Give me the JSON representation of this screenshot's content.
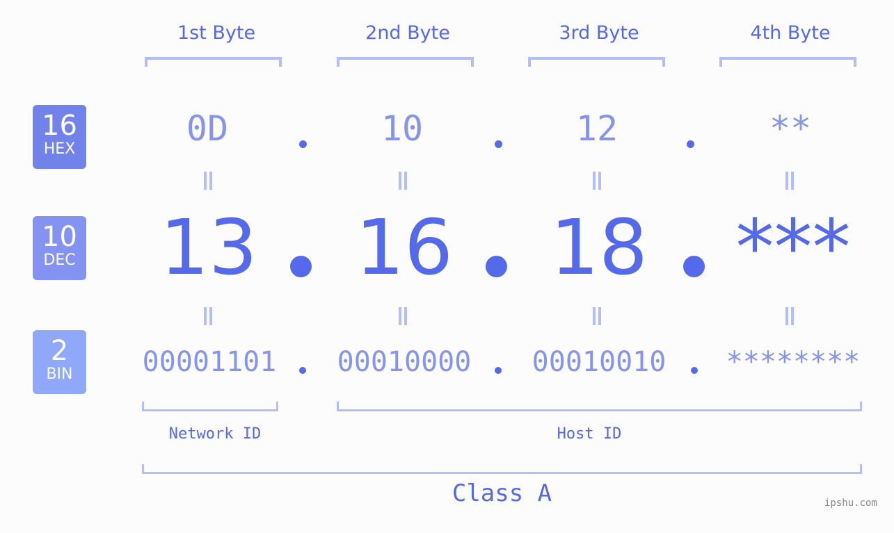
{
  "byte_headers": [
    "1st Byte",
    "2nd Byte",
    "3rd Byte",
    "4th Byte"
  ],
  "badges": [
    {
      "number": "16",
      "label": "HEX",
      "color": "#7282eb"
    },
    {
      "number": "10",
      "label": "DEC",
      "color": "#8493f1"
    },
    {
      "number": "2",
      "label": "BIN",
      "color": "#8fa8f9"
    }
  ],
  "hex": [
    "0D",
    "10",
    "12",
    "**"
  ],
  "dec": [
    "13",
    "16",
    "18",
    "***"
  ],
  "bin": [
    "00001101",
    "00010000",
    "00010010",
    "********"
  ],
  "network_id_label": "Network ID",
  "host_id_label": "Host ID",
  "class_label": "Class A",
  "watermark": "ipshu.com",
  "colors": {
    "accent": "#546aea",
    "light": "#8794ec",
    "bracket": "#b3bdf7",
    "background": "#fbfcfb"
  }
}
